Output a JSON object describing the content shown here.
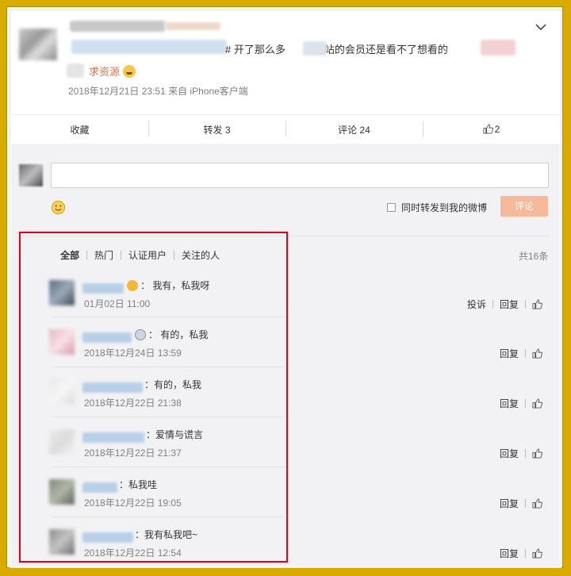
{
  "post": {
    "text_prefix": "#",
    "text_main": " 开了那么多",
    "text_mid": "网站的会员还是看不了想看的",
    "tag": "求资源",
    "time": "2018年12月21日 23:51 来自 iPhone客户端"
  },
  "actions": {
    "collect": "收藏",
    "forward": "转发 3",
    "comment": "评论 24",
    "like": "2"
  },
  "composer": {
    "input_value": "",
    "sync_label": "同时转发到我的微博",
    "submit_label": "评论"
  },
  "list": {
    "tabs": [
      "全部",
      "热门",
      "认证用户",
      "关注的人"
    ],
    "total": "共16条",
    "comments": [
      {
        "text": "：  我有，私我呀",
        "time": "01月02日 11:00",
        "report": "投诉",
        "reply": "回复"
      },
      {
        "text": "：  有的，私我",
        "time": "2018年12月24日 13:59",
        "reply": "回复"
      },
      {
        "text": "：有的，私我",
        "time": "2018年12月22日 21:38",
        "reply": "回复"
      },
      {
        "text": "：爱情与谎言",
        "time": "2018年12月22日 21:37",
        "reply": "回复"
      },
      {
        "text": "：私我哇",
        "time": "2018年12月22日 19:05",
        "reply": "回复"
      },
      {
        "text": "：我有私我吧~",
        "time": "2018年12月22日 12:54",
        "reply": "回复"
      }
    ]
  },
  "colors": {
    "frame": "#d9ab00",
    "accent": "#eb7350",
    "submit": "#f7b999",
    "highlight_box": "#e60012"
  },
  "icons": [
    "chevron-down-icon",
    "thumbs-up-icon",
    "smile-icon",
    "emoji-icon"
  ]
}
